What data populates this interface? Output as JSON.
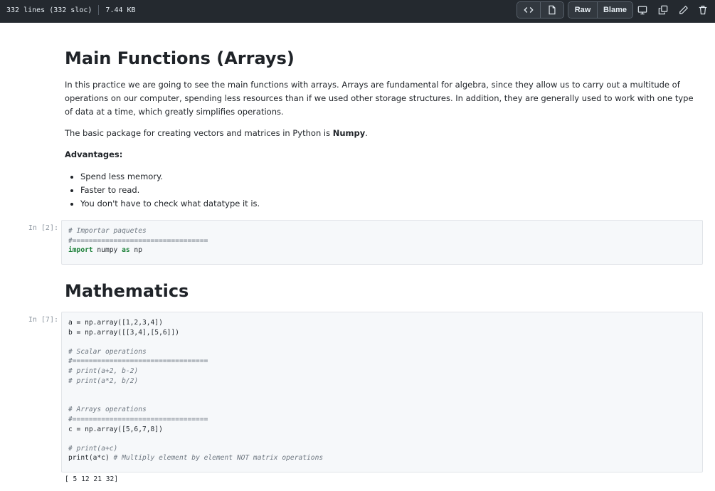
{
  "toolbar": {
    "lines_info": "332 lines (332 sloc)",
    "size": "7.44 KB",
    "raw_label": "Raw",
    "blame_label": "Blame",
    "icons": [
      "code-icon",
      "file-icon",
      "desktop-icon",
      "copy-icon",
      "pencil-icon",
      "trash-icon"
    ]
  },
  "notebook": {
    "title": "Main Functions (Arrays)",
    "intro": "In this practice we are going to see the main functions with arrays. Arrays are fundamental for algebra, since they allow us to carry out a multitude of operations on our computer, spending less resources than if we used other storage structures. In addition, they are generally used to work with one type of data at a time, which greatly simplifies operations.",
    "package_text": "The basic package for creating vectors and matrices in Python is ",
    "package_name": "Numpy",
    "package_end": ".",
    "advantages_heading": "Advantages:",
    "advantages": [
      "Spend less memory.",
      "Faster to read.",
      "You don't have to check what datatype it is."
    ],
    "cell1_prompt": "In [2]:",
    "cell1": {
      "comment1": "# Importar paquetes",
      "comment2": "#=================================",
      "kw_import": "import",
      "module": " numpy ",
      "kw_as": "as",
      "alias": " np"
    },
    "section2_title": "Mathematics",
    "cell2_prompt": "In [7]:",
    "cell2": {
      "a_def": "a = np.array([1,2,3,4])",
      "b_def": "b = np.array([[3,4],[5,6]])",
      "c_scalar": "# Scalar operations",
      "c_sep1": "#=================================",
      "c_p1": "# print(a+2, b-2)",
      "c_p2": "# print(a*2, b/2)",
      "c_arrays": "# Arrays operations",
      "c_sep2": "#=================================",
      "c_def": "c = np.array([5,6,7,8])",
      "c_p3": "# print(a+c)",
      "print_stmt": "print(a*c) ",
      "print_comment": "# Multiply element by element NOT matrix operations"
    },
    "output": "[ 5 12 21 32]"
  }
}
